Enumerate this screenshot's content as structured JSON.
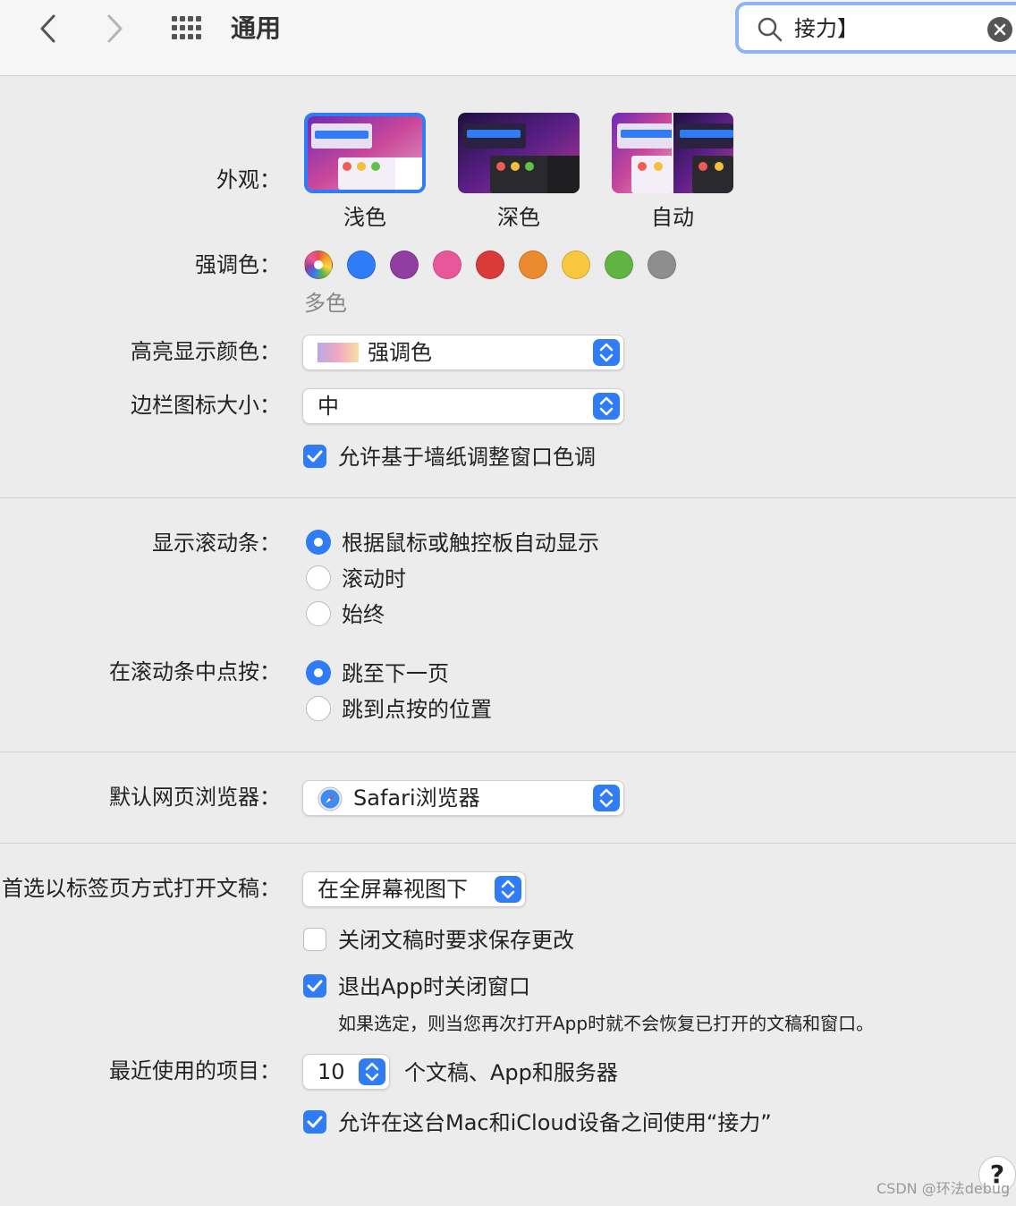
{
  "window": {
    "title": "通用"
  },
  "search": {
    "value": "接力】"
  },
  "appearance": {
    "label": "外观：",
    "options": [
      "浅色",
      "深色",
      "自动"
    ],
    "selected": "浅色"
  },
  "accent": {
    "label": "强调色：",
    "selected_name": "多色",
    "colors": [
      "multicolor",
      "#2f7cf6",
      "#8e3fa0",
      "#e9579b",
      "#d93a3a",
      "#ec8a2f",
      "#f7c83e",
      "#61b343",
      "#8e8e8e"
    ]
  },
  "highlight": {
    "label": "高亮显示颜色：",
    "value": "强调色"
  },
  "sidebar_icon": {
    "label": "边栏图标大小：",
    "value": "中"
  },
  "wallpaper_tint": {
    "label": "允许基于墙纸调整窗口色调",
    "checked": true
  },
  "scrollbars": {
    "label": "显示滚动条：",
    "options": [
      "根据鼠标或触控板自动显示",
      "滚动时",
      "始终"
    ],
    "selected": 0
  },
  "click_scrollbar": {
    "label": "在滚动条中点按：",
    "options": [
      "跳至下一页",
      "跳到点按的位置"
    ],
    "selected": 0
  },
  "browser": {
    "label": "默认网页浏览器：",
    "value": "Safari浏览器"
  },
  "tabs": {
    "label": "首选以标签页方式打开文稿：",
    "value": "在全屏幕视图下"
  },
  "ask_save": {
    "label": "关闭文稿时要求保存更改",
    "checked": false
  },
  "close_windows": {
    "label": "退出App时关闭窗口",
    "checked": true,
    "note": "如果选定，则当您再次打开App时就不会恢复已打开的文稿和窗口。"
  },
  "recent": {
    "label": "最近使用的项目：",
    "value": "10",
    "suffix": "个文稿、App和服务器"
  },
  "handoff": {
    "label": "允许在这台Mac和iCloud设备之间使用“接力”",
    "checked": true
  },
  "help": {
    "label": "?"
  },
  "watermark": "CSDN @环法debug"
}
